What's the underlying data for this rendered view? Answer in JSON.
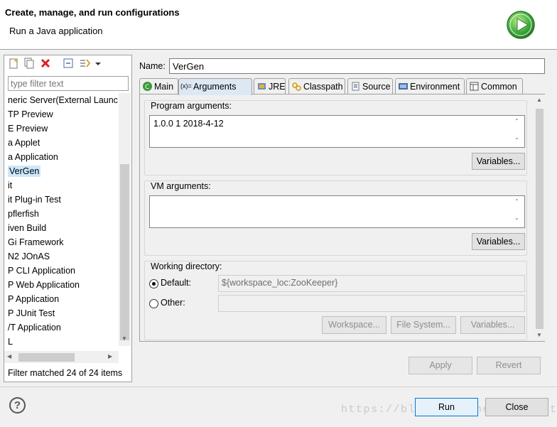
{
  "header": {
    "title": "Create, manage, and run configurations",
    "message": "Run a Java application",
    "run_icon": "run-play-icon",
    "accent_color": "#3aa63a"
  },
  "left_panel": {
    "toolbar_icons": [
      "new-config-icon",
      "duplicate-icon",
      "delete-icon",
      "collapse-all-icon",
      "filter-icon",
      "view-menu-icon"
    ],
    "filter_placeholder": "type filter text",
    "tree_items": [
      {
        "label": "neric Server(External Launc",
        "selected": false
      },
      {
        "label": "TP Preview",
        "selected": false
      },
      {
        "label": "E Preview",
        "selected": false
      },
      {
        "label": "a Applet",
        "selected": false
      },
      {
        "label": "a Application",
        "selected": false
      },
      {
        "label": "VerGen",
        "selected": true
      },
      {
        "label": "it",
        "selected": false
      },
      {
        "label": "it Plug-in Test",
        "selected": false
      },
      {
        "label": "pflerfish",
        "selected": false
      },
      {
        "label": "iven Build",
        "selected": false
      },
      {
        "label": "Gi Framework",
        "selected": false
      },
      {
        "label": "N2 JOnAS",
        "selected": false
      },
      {
        "label": "P CLI Application",
        "selected": false
      },
      {
        "label": "P Web Application",
        "selected": false
      },
      {
        "label": "P Application",
        "selected": false
      },
      {
        "label": "P JUnit Test",
        "selected": false
      },
      {
        "label": "/T Application",
        "selected": false
      },
      {
        "label": "L",
        "selected": false
      }
    ],
    "status": "Filter matched 24 of 24 items"
  },
  "config": {
    "name_label": "Name:",
    "name_value": "VerGen",
    "tabs": [
      {
        "label": "Main",
        "icon": "main-tab-icon",
        "active": false
      },
      {
        "label": "Arguments",
        "icon": "arguments-tab-icon",
        "active": true
      },
      {
        "label": "JRE",
        "icon": "jre-tab-icon",
        "active": false
      },
      {
        "label": "Classpath",
        "icon": "classpath-tab-icon",
        "active": false
      },
      {
        "label": "Source",
        "icon": "source-tab-icon",
        "active": false
      },
      {
        "label": "Environment",
        "icon": "environment-tab-icon",
        "active": false
      },
      {
        "label": "Common",
        "icon": "common-tab-icon",
        "active": false
      }
    ],
    "program_args": {
      "title": "Program arguments:",
      "value": "1.0.0 1 2018-4-12",
      "variables_button": "Variables..."
    },
    "vm_args": {
      "title": "VM arguments:",
      "value": "",
      "variables_button": "Variables..."
    },
    "working_dir": {
      "title": "Working directory:",
      "default_label": "Default:",
      "default_value": "${workspace_loc:ZooKeeper}",
      "other_label": "Other:",
      "other_value": "",
      "workspace_button": "Workspace...",
      "filesystem_button": "File System...",
      "variables_button": "Variables..."
    },
    "apply_button": "Apply",
    "revert_button": "Revert"
  },
  "footer": {
    "run_button": "Run",
    "close_button": "Close",
    "watermark": "https://blog.csdn.net/chenxyt"
  }
}
